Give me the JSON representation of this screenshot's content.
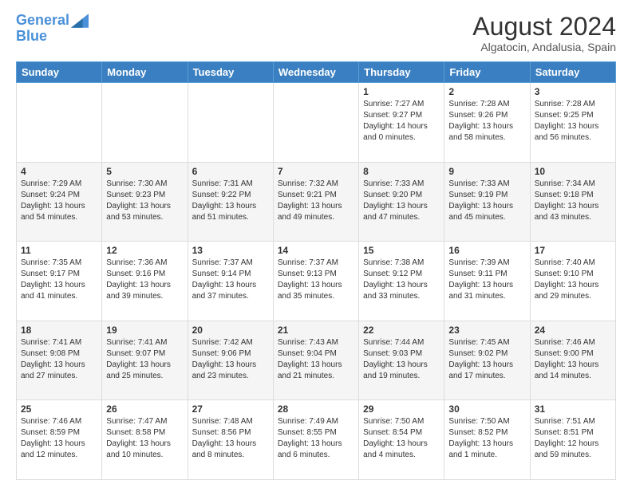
{
  "logo": {
    "line1": "General",
    "line2": "Blue"
  },
  "header": {
    "month": "August 2024",
    "location": "Algatocin, Andalusia, Spain"
  },
  "weekdays": [
    "Sunday",
    "Monday",
    "Tuesday",
    "Wednesday",
    "Thursday",
    "Friday",
    "Saturday"
  ],
  "weeks": [
    [
      {
        "day": "",
        "info": ""
      },
      {
        "day": "",
        "info": ""
      },
      {
        "day": "",
        "info": ""
      },
      {
        "day": "",
        "info": ""
      },
      {
        "day": "1",
        "info": "Sunrise: 7:27 AM\nSunset: 9:27 PM\nDaylight: 14 hours\nand 0 minutes."
      },
      {
        "day": "2",
        "info": "Sunrise: 7:28 AM\nSunset: 9:26 PM\nDaylight: 13 hours\nand 58 minutes."
      },
      {
        "day": "3",
        "info": "Sunrise: 7:28 AM\nSunset: 9:25 PM\nDaylight: 13 hours\nand 56 minutes."
      }
    ],
    [
      {
        "day": "4",
        "info": "Sunrise: 7:29 AM\nSunset: 9:24 PM\nDaylight: 13 hours\nand 54 minutes."
      },
      {
        "day": "5",
        "info": "Sunrise: 7:30 AM\nSunset: 9:23 PM\nDaylight: 13 hours\nand 53 minutes."
      },
      {
        "day": "6",
        "info": "Sunrise: 7:31 AM\nSunset: 9:22 PM\nDaylight: 13 hours\nand 51 minutes."
      },
      {
        "day": "7",
        "info": "Sunrise: 7:32 AM\nSunset: 9:21 PM\nDaylight: 13 hours\nand 49 minutes."
      },
      {
        "day": "8",
        "info": "Sunrise: 7:33 AM\nSunset: 9:20 PM\nDaylight: 13 hours\nand 47 minutes."
      },
      {
        "day": "9",
        "info": "Sunrise: 7:33 AM\nSunset: 9:19 PM\nDaylight: 13 hours\nand 45 minutes."
      },
      {
        "day": "10",
        "info": "Sunrise: 7:34 AM\nSunset: 9:18 PM\nDaylight: 13 hours\nand 43 minutes."
      }
    ],
    [
      {
        "day": "11",
        "info": "Sunrise: 7:35 AM\nSunset: 9:17 PM\nDaylight: 13 hours\nand 41 minutes."
      },
      {
        "day": "12",
        "info": "Sunrise: 7:36 AM\nSunset: 9:16 PM\nDaylight: 13 hours\nand 39 minutes."
      },
      {
        "day": "13",
        "info": "Sunrise: 7:37 AM\nSunset: 9:14 PM\nDaylight: 13 hours\nand 37 minutes."
      },
      {
        "day": "14",
        "info": "Sunrise: 7:37 AM\nSunset: 9:13 PM\nDaylight: 13 hours\nand 35 minutes."
      },
      {
        "day": "15",
        "info": "Sunrise: 7:38 AM\nSunset: 9:12 PM\nDaylight: 13 hours\nand 33 minutes."
      },
      {
        "day": "16",
        "info": "Sunrise: 7:39 AM\nSunset: 9:11 PM\nDaylight: 13 hours\nand 31 minutes."
      },
      {
        "day": "17",
        "info": "Sunrise: 7:40 AM\nSunset: 9:10 PM\nDaylight: 13 hours\nand 29 minutes."
      }
    ],
    [
      {
        "day": "18",
        "info": "Sunrise: 7:41 AM\nSunset: 9:08 PM\nDaylight: 13 hours\nand 27 minutes."
      },
      {
        "day": "19",
        "info": "Sunrise: 7:41 AM\nSunset: 9:07 PM\nDaylight: 13 hours\nand 25 minutes."
      },
      {
        "day": "20",
        "info": "Sunrise: 7:42 AM\nSunset: 9:06 PM\nDaylight: 13 hours\nand 23 minutes."
      },
      {
        "day": "21",
        "info": "Sunrise: 7:43 AM\nSunset: 9:04 PM\nDaylight: 13 hours\nand 21 minutes."
      },
      {
        "day": "22",
        "info": "Sunrise: 7:44 AM\nSunset: 9:03 PM\nDaylight: 13 hours\nand 19 minutes."
      },
      {
        "day": "23",
        "info": "Sunrise: 7:45 AM\nSunset: 9:02 PM\nDaylight: 13 hours\nand 17 minutes."
      },
      {
        "day": "24",
        "info": "Sunrise: 7:46 AM\nSunset: 9:00 PM\nDaylight: 13 hours\nand 14 minutes."
      }
    ],
    [
      {
        "day": "25",
        "info": "Sunrise: 7:46 AM\nSunset: 8:59 PM\nDaylight: 13 hours\nand 12 minutes."
      },
      {
        "day": "26",
        "info": "Sunrise: 7:47 AM\nSunset: 8:58 PM\nDaylight: 13 hours\nand 10 minutes."
      },
      {
        "day": "27",
        "info": "Sunrise: 7:48 AM\nSunset: 8:56 PM\nDaylight: 13 hours\nand 8 minutes."
      },
      {
        "day": "28",
        "info": "Sunrise: 7:49 AM\nSunset: 8:55 PM\nDaylight: 13 hours\nand 6 minutes."
      },
      {
        "day": "29",
        "info": "Sunrise: 7:50 AM\nSunset: 8:54 PM\nDaylight: 13 hours\nand 4 minutes."
      },
      {
        "day": "30",
        "info": "Sunrise: 7:50 AM\nSunset: 8:52 PM\nDaylight: 13 hours\nand 1 minute."
      },
      {
        "day": "31",
        "info": "Sunrise: 7:51 AM\nSunset: 8:51 PM\nDaylight: 12 hours\nand 59 minutes."
      }
    ]
  ]
}
